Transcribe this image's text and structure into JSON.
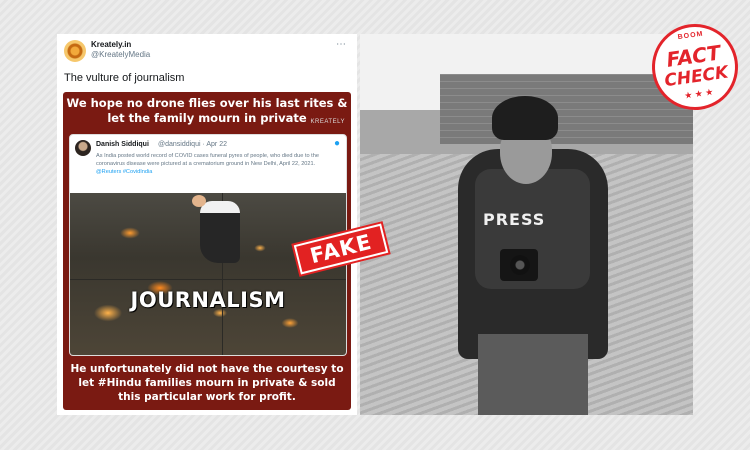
{
  "tweet": {
    "name": "Kreately.in",
    "handle": "@KreatelyMedia",
    "more_icon": "⋯",
    "text": "The vulture of journalism"
  },
  "meme": {
    "top_text": "We hope no drone flies over his last rites & let the family mourn in private",
    "brand": "KREATELY",
    "embedded_tweet": {
      "name": "Danish Siddiqui",
      "handle": "@dansiddiqui · Apr 22",
      "body": "As India posted world record of COVID cases funeral pyres of people, who died due to the coronavirus disease were pictured at a crematorium ground in New Delhi, April 22, 2021.",
      "links": "@Reuters #CovidIndia"
    },
    "overlay_word": "JOURNALISM",
    "bottom_text": "He unfortunately did not have the courtesy to let #Hindu families mourn in private & sold this particular work for profit."
  },
  "stamp": {
    "label": "FAKE",
    "color": "#e22222"
  },
  "photo": {
    "vest_text": "PRESS"
  },
  "badge": {
    "top": "BOOM",
    "line1": "FACT",
    "line2": "CHECK",
    "stars": "★ ★ ★",
    "color": "#e3242b"
  }
}
